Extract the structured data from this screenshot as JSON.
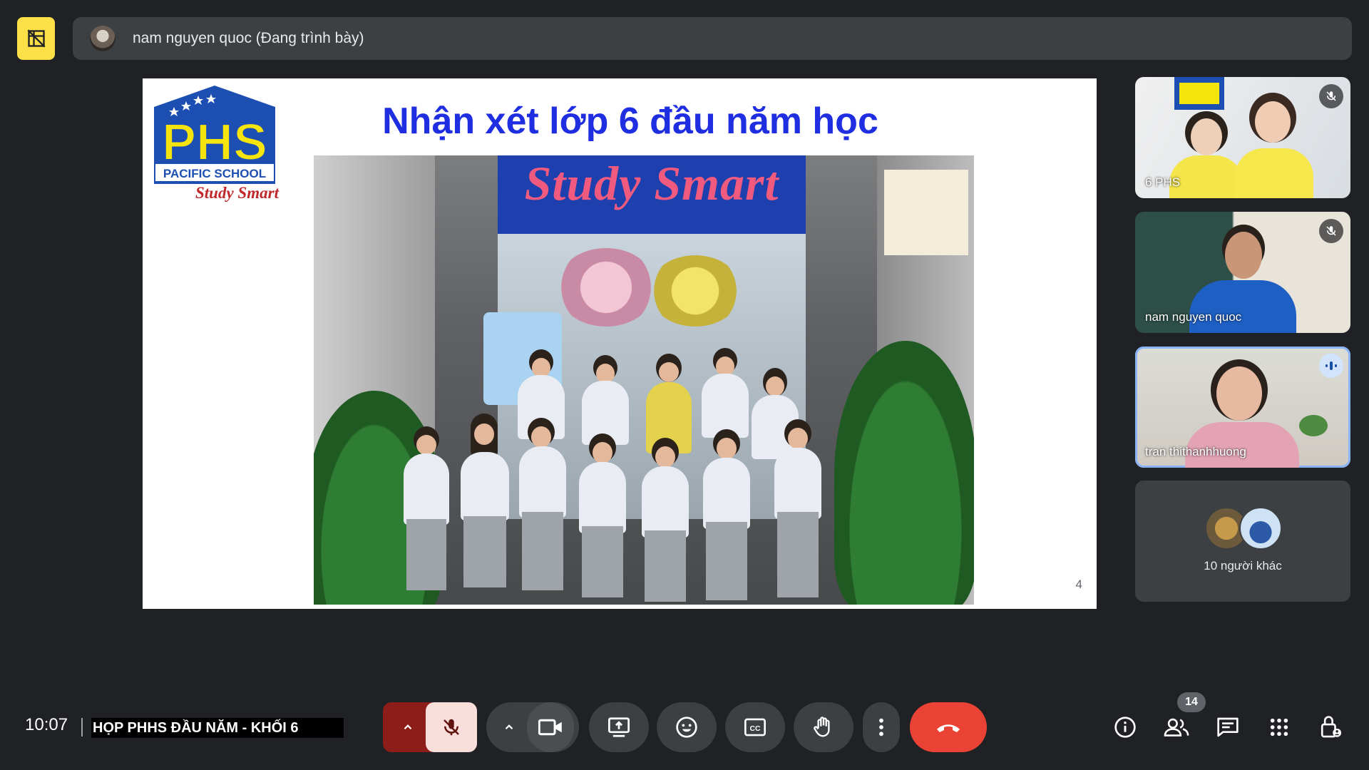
{
  "presenter": {
    "label": "nam nguyen quoc (Đang trình bày)"
  },
  "slide": {
    "logo_text": "PHS",
    "logo_subtext": "PACIFIC SCHOOL",
    "logo_tagline": "Study Smart",
    "title": "Nhận xét lớp 6 đầu năm học",
    "photo_banner": "Study Smart",
    "page_number": "4"
  },
  "participants": [
    {
      "name": "6 PHS",
      "muted": true
    },
    {
      "name": "nam nguyen quoc",
      "muted": true
    },
    {
      "name": "tran thithanhhuong",
      "speaking": true
    }
  ],
  "others": {
    "label": "10 người khác"
  },
  "bottom_bar": {
    "time": "10:07",
    "meeting_name": "HỌP PHHS  ĐẦU NĂM - KHỐI 6",
    "people_count": "14"
  },
  "colors": {
    "background": "#202124",
    "end_call": "#ea4335",
    "mic_off": "#f9dedc",
    "slide_title": "#1f2ee0",
    "active_speaker": "#8ab4f8"
  }
}
